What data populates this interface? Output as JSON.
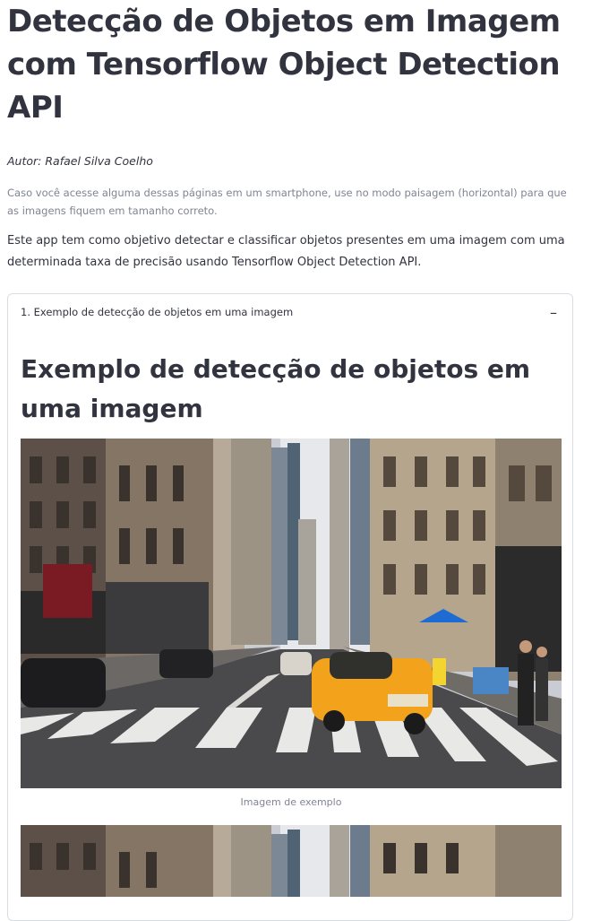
{
  "title": "Detecção de Objetos em Imagem com Tensorflow Object Detection API",
  "author": "Autor: Rafael Silva Coelho",
  "note": "Caso você acesse alguma dessas páginas em um smartphone, use no modo paisagem (horizontal) para que as imagens fiquem em tamanho correto.",
  "description": "Este app tem como objetivo detectar e classificar objetos presentes em uma imagem com uma determinada taxa de precisão usando Tensorflow Object Detection API.",
  "expander": {
    "label": "1. Exemplo de detecção de objetos em uma imagem",
    "toggle_icon": "minus-icon",
    "toggle_symbol": "–",
    "heading": "Exemplo de detecção de objetos em uma imagem",
    "image_caption": "Imagem de exemplo"
  },
  "colors": {
    "text": "#31333f",
    "muted": "#808495",
    "border": "#dadce3",
    "taxi": "#f2a31b"
  }
}
